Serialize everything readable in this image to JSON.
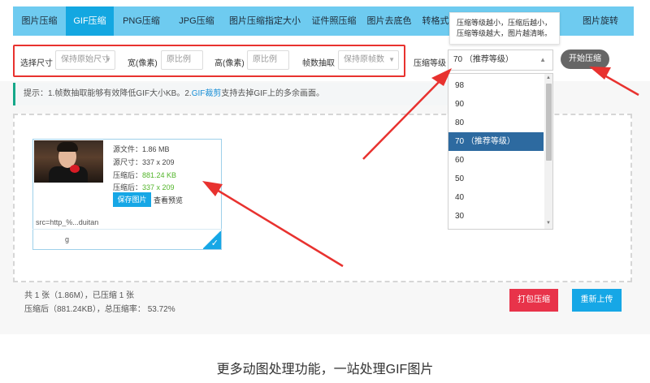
{
  "nav": {
    "tabs": [
      {
        "label": "图片压缩",
        "active": false
      },
      {
        "label": "GIF压缩",
        "active": true
      },
      {
        "label": "PNG压缩",
        "active": false
      },
      {
        "label": "JPG压缩",
        "active": false
      },
      {
        "label": "图片压缩指定大小",
        "active": false
      },
      {
        "label": "证件照压缩",
        "active": false
      },
      {
        "label": "图片去底色",
        "active": false
      },
      {
        "label": "转格式",
        "active": false
      },
      {
        "label": "图片旋转",
        "active": false
      }
    ]
  },
  "toolbar": {
    "size_label": "选择尺寸",
    "size_value": "保持原始尺寸",
    "width_label": "宽(像素)",
    "width_placeholder": "原比例",
    "height_label": "高(像素)",
    "height_placeholder": "原比例",
    "frame_label": "帧数抽取",
    "frame_value": "保持原帧数",
    "level_label": "压缩等级",
    "level_value": "70 （推荐等级）",
    "start_label": "开始压缩"
  },
  "tooltip": {
    "line1": "压缩等级越小，压缩后越小，",
    "line2": "压缩等级越大，图片越清晰。"
  },
  "dropdown": {
    "items": [
      {
        "label": "98",
        "selected": false
      },
      {
        "label": "90",
        "selected": false
      },
      {
        "label": "80",
        "selected": false
      },
      {
        "label": "70 （推荐等级）",
        "selected": true
      },
      {
        "label": "60",
        "selected": false
      },
      {
        "label": "50",
        "selected": false
      },
      {
        "label": "40",
        "selected": false
      },
      {
        "label": "30",
        "selected": false
      }
    ]
  },
  "tip": {
    "prefix": "提示：1.帧数抽取能够有效降低GIF大小KB。2.",
    "link": "GIF裁剪",
    "suffix": "支持去掉GIF上的多余画面。"
  },
  "file": {
    "orig_size": "源文件：1.86 MB",
    "orig_dim": "源尺寸：337 x 209",
    "new_size_label": "压缩后：",
    "new_size_value": "881.24 KB",
    "new_dim_label": "压缩后：",
    "new_dim_value": "337 x 209",
    "save_label": "保存图片",
    "preview_label": "查看预览",
    "src_text": "src=http_%...duitan",
    "src_tail": "g"
  },
  "summary": {
    "line1": "共 1 张（1.86M），已压缩 1 张",
    "line2": "压缩后（881.24KB），总压缩率： 53.72%"
  },
  "actions": {
    "pack_label": "打包压缩",
    "reupload_label": "重新上传"
  },
  "footer": {
    "title": "更多动图处理功能，一站处理GIF图片"
  },
  "colors": {
    "nav_bg": "#6ecbf0",
    "nav_active": "#13a7e1",
    "annotation_red": "#e8322f",
    "primary_blue": "#16a7e6",
    "danger_red": "#e8334a",
    "success_green": "#52b52a",
    "selected_option": "#2d6aa0"
  }
}
